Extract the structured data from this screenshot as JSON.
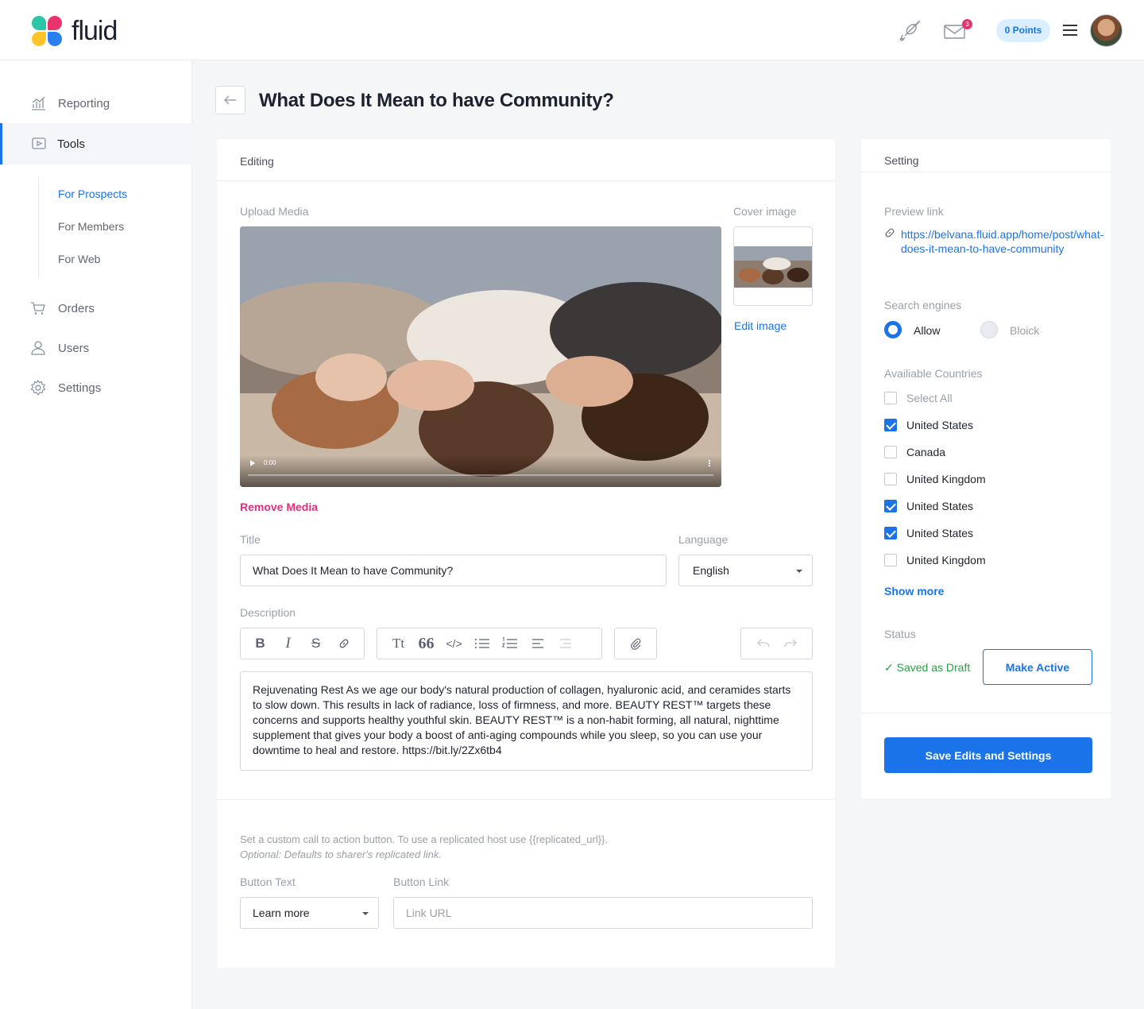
{
  "app": {
    "name": "fluid"
  },
  "header": {
    "points_label": "0 Points",
    "mail_badge": "3"
  },
  "sidebar": {
    "items": [
      {
        "label": "Reporting",
        "icon": "chart-icon"
      },
      {
        "label": "Tools",
        "icon": "tools-icon"
      },
      {
        "label": "Orders",
        "icon": "cart-icon"
      },
      {
        "label": "Users",
        "icon": "user-icon"
      },
      {
        "label": "Settings",
        "icon": "gear-icon"
      }
    ],
    "subitems": [
      "For Prospects",
      "For Members",
      "For Web"
    ]
  },
  "page": {
    "title": "What Does It Mean to have Community?"
  },
  "editing": {
    "header": "Editing",
    "upload_label": "Upload Media",
    "cover_label": "Cover image",
    "edit_image": "Edit image",
    "video_time": "0:00",
    "remove_media": "Remove Media",
    "title_label": "Title",
    "title_value": "What Does It Mean to have Community?",
    "language_label": "Language",
    "language_value": "English",
    "description_label": "Description",
    "toolbar": {
      "bold": "B",
      "italic": "I",
      "strike": "S",
      "heading": "Tt",
      "quote": "66",
      "code": "</>"
    },
    "description": "Rejuvenating Rest As we age our body's natural production of collagen, hyaluronic acid, and ceramides starts to slow down. This results in lack of radiance, loss of firmness, and more. BEAUTY REST™ targets these concerns and supports healthy youthful skin. BEAUTY REST™ is a non-habit forming, all natural, nighttime supplement that gives your body a boost of anti-aging compounds while you sleep, so you can use your downtime to heal and restore. https://bit.ly/2Zx6tb4",
    "cta_note": "Set a custom call to action button. To use a replicated host use {{replicated_url}}.",
    "cta_optional": "Optional: Defaults to sharer's replicated link.",
    "button_text_label": "Button Text",
    "button_text_value": "Learn more",
    "button_link_label": "Button Link",
    "button_link_placeholder": "Link URL"
  },
  "setting": {
    "header": "Setting",
    "preview_label": "Preview link",
    "preview_url": "https://belvana.fluid.app/home/post/what-does-it-mean-to-have-community",
    "search_label": "Search engines",
    "allow": "Allow",
    "block": "Bloick",
    "search_engines_selected": "Allow",
    "countries_label": "Availiable Countries",
    "countries": [
      {
        "label": "Select All",
        "checked": false
      },
      {
        "label": "United States",
        "checked": true
      },
      {
        "label": "Canada",
        "checked": false
      },
      {
        "label": "United Kingdom",
        "checked": false
      },
      {
        "label": "United States",
        "checked": true
      },
      {
        "label": "United States",
        "checked": true
      },
      {
        "label": "United Kingdom",
        "checked": false
      }
    ],
    "show_more": "Show more",
    "status_label": "Status",
    "status_value": "✓ Saved as Draft",
    "make_active": "Make Active",
    "save_button": "Save Edits and Settings"
  },
  "colors": {
    "accent": "#1a73e8",
    "danger": "#e0307a",
    "success": "#2e9e44"
  }
}
